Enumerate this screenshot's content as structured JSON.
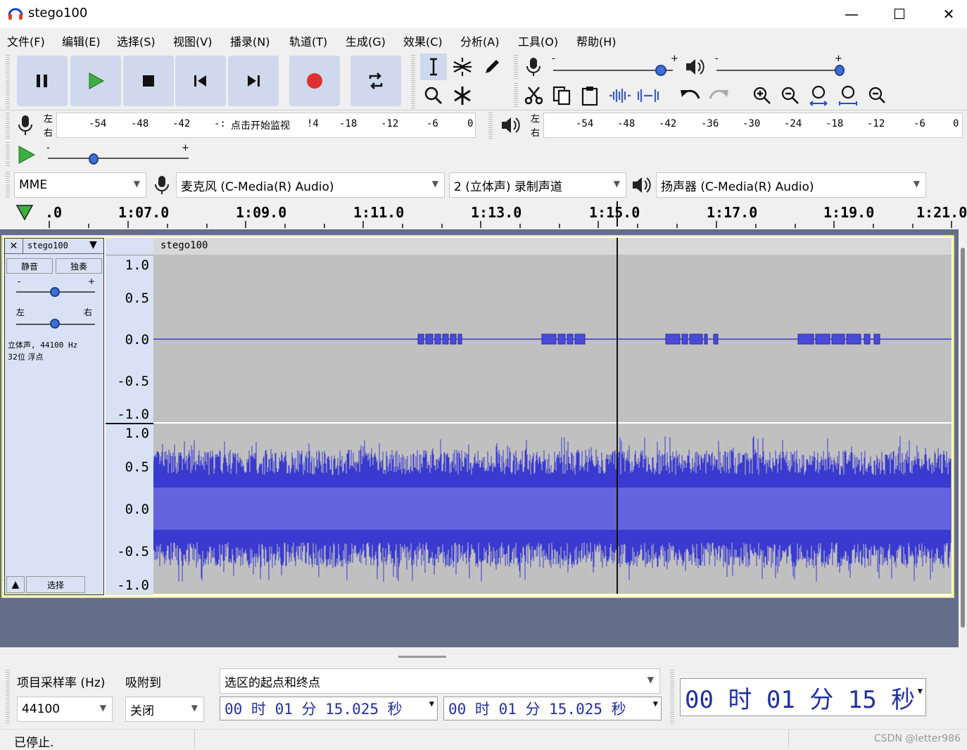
{
  "window": {
    "title": "stego100"
  },
  "menu": [
    "文件(F)",
    "编辑(E)",
    "选择(S)",
    "视图(V)",
    "播录(N)",
    "轨道(T)",
    "生成(G)",
    "效果(C)",
    "分析(A)",
    "工具(O)",
    "帮助(H)"
  ],
  "transport": {
    "pause": "pause-icon",
    "play": "play-icon",
    "stop": "stop-icon",
    "skip_start": "skip-start-icon",
    "skip_end": "skip-end-icon",
    "record": "record-icon",
    "loop": "loop-icon"
  },
  "meters": {
    "rec_lr": [
      "左",
      "右"
    ],
    "rec_scale": [
      "-54",
      "-48",
      "-42",
      "-:",
      "点击开始监视",
      "!4",
      "-18",
      "-12",
      "-6",
      "0"
    ],
    "play_lr": [
      "左",
      "右"
    ],
    "play_scale": [
      "-54",
      "-48",
      "-42",
      "-36",
      "-30",
      "-24",
      "-18",
      "-12",
      "-6",
      "0"
    ],
    "slider_minus": "-",
    "slider_plus": "+"
  },
  "device": {
    "host": "MME",
    "mic": "麦克风 (C-Media(R) Audio)",
    "channels": "2 (立体声) 录制声道",
    "speaker": "扬声器 (C-Media(R) Audio)"
  },
  "ruler": {
    "labels": [
      ".0",
      "1:07.0",
      "1:09.0",
      "1:11.0",
      "1:13.0",
      "1:15.0",
      "1:17.0",
      "1:19.0",
      "1:21.0"
    ]
  },
  "track": {
    "name": "stego100",
    "label": "stego100",
    "mute": "静音",
    "solo": "独奏",
    "gain_minus": "-",
    "gain_plus": "+",
    "pan_left": "左",
    "pan_right": "右",
    "info_line1": "立体声, 44100 Hz",
    "info_line2": "32位 浮点",
    "select": "选择",
    "vticks_top": [
      "1.0",
      "0.5",
      "0.0",
      "-0.5",
      "-1.0"
    ],
    "vticks_bottom": [
      "1.0",
      "0.5",
      "0.0",
      "-0.5",
      "-1.0"
    ]
  },
  "selection": {
    "rate_label": "项目采样率 (Hz)",
    "snap_label": "吸附到",
    "range_label": "选区的起点和终点",
    "rate_value": "44100",
    "snap_value": "关闭",
    "start_time": "00 时 01 分 15.025 秒",
    "end_time": "00 时 01 分 15.025 秒",
    "big_time": "00 时 01 分 15 秒"
  },
  "status": {
    "text": "已停止.",
    "watermark": "CSDN @letter986"
  },
  "colors": {
    "waveform": "#3a3ad0",
    "waveform_rms": "#6464e0",
    "track_bg": "#c0c0c0",
    "panel": "#d8e2f4",
    "record": "#e03030",
    "play": "#3cb03c"
  }
}
